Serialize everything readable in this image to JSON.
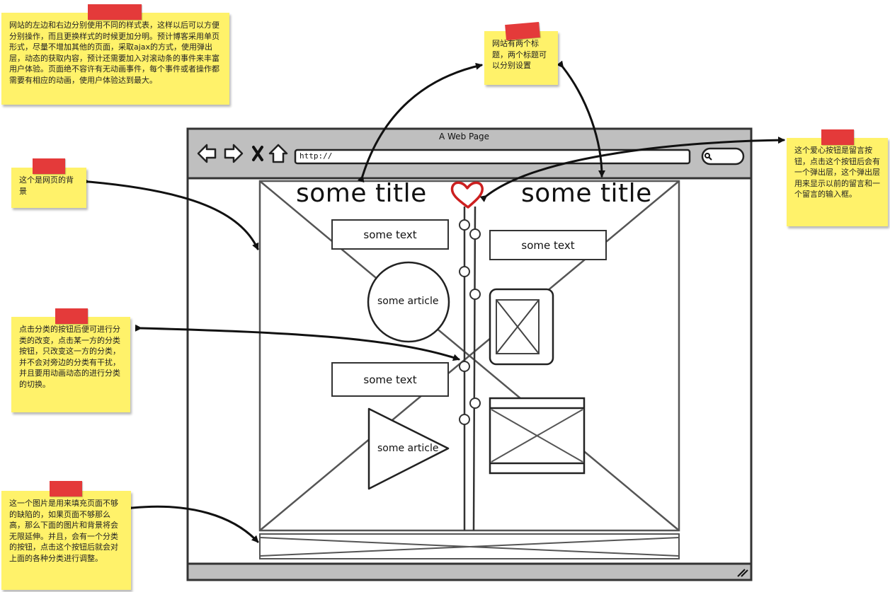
{
  "window": {
    "title": "A Web Page",
    "url": "http://",
    "nav_icons": [
      "back-arrow-icon",
      "forward-arrow-icon",
      "close-x-icon",
      "home-icon"
    ],
    "search_icon": "search-icon"
  },
  "page": {
    "left_title": "some title",
    "right_title": "some title",
    "heart_icon": "heart-icon",
    "left_text_1": "some text",
    "left_article_1": "some article",
    "left_text_2": "some text",
    "left_article_2": "some article",
    "right_text_1": "some text"
  },
  "notes": {
    "top_left": "网站的左边和右边分别使用不同的样式表，这样以后可以方便分别操作，而且更换样式的时候更加分明。预计博客采用单页形式，尽量不增加其他的页面，采取ajax的方式，使用弹出层，动态的获取内容，预计还需要加入对滚动条的事件来丰富用户体验。页面绝不容许有无动画事件，每个事件或者操作都需要有相应的动画，使用户体验达到最大。",
    "top_center": "网站有两个标题，两个标题可以分别设置",
    "right": "这个爱心按钮是留言按钮，点击这个按钮后会有一个弹出层，这个弹出层用来显示以前的留言和一个留言的输入框。",
    "left_1": "这个是网页的背景",
    "left_2": "点击分类的按钮后便可进行分类的改变，点击某一方的分类按钮，只改变这一方的分类，并不会对旁边的分类有干扰，并且要用动画动态的进行分类的切换。",
    "left_3": "这一个图片是用来填充页面不够的缺陷的，如果页面不够那么高，那么下面的图片和背景将会无限延伸。并且，会有一个分类的按钮，点击这个按钮后就会对上面的各种分类进行调整。"
  },
  "colors": {
    "note": "#fff26a",
    "tape": "#e43a3a",
    "chrome": "#bfbfbf",
    "heart": "#cc1f1f",
    "ink": "#333333"
  }
}
